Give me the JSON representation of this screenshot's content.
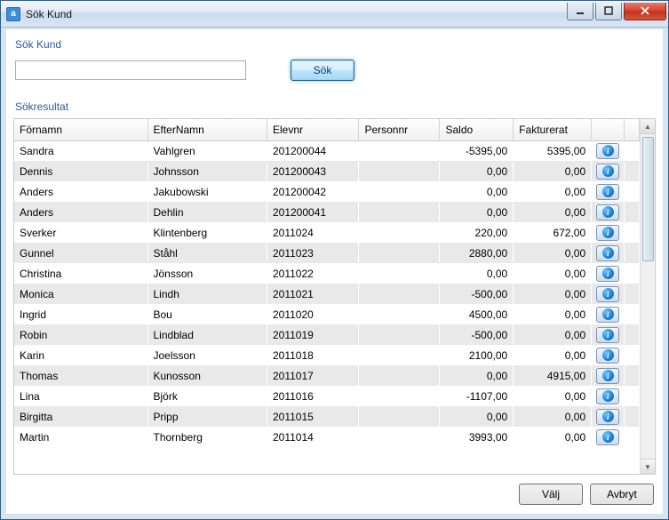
{
  "window": {
    "title": "Sök Kund"
  },
  "groups": {
    "search": "Sök Kund",
    "results": "Sökresultat"
  },
  "search": {
    "value": "",
    "button": "Sök"
  },
  "columns": {
    "fornamn": "Förnamn",
    "efternamn": "EfterNamn",
    "elevnr": "Elevnr",
    "personnr": "Personnr",
    "saldo": "Saldo",
    "fakturerat": "Fakturerat"
  },
  "rows": [
    {
      "fornamn": "Sandra",
      "efternamn": "Vahlgren",
      "elevnr": "201200044",
      "personnr": "",
      "saldo": "-5395,00",
      "fakturerat": "5395,00"
    },
    {
      "fornamn": "Dennis",
      "efternamn": "Johnsson",
      "elevnr": "201200043",
      "personnr": "",
      "saldo": "0,00",
      "fakturerat": "0,00"
    },
    {
      "fornamn": "Anders",
      "efternamn": "Jakubowski",
      "elevnr": "201200042",
      "personnr": "",
      "saldo": "0,00",
      "fakturerat": "0,00"
    },
    {
      "fornamn": "Anders",
      "efternamn": "Dehlin",
      "elevnr": "201200041",
      "personnr": "",
      "saldo": "0,00",
      "fakturerat": "0,00"
    },
    {
      "fornamn": "Sverker",
      "efternamn": "Klintenberg",
      "elevnr": "2011024",
      "personnr": "",
      "saldo": "220,00",
      "fakturerat": "672,00"
    },
    {
      "fornamn": "Gunnel",
      "efternamn": "Ståhl",
      "elevnr": "2011023",
      "personnr": "",
      "saldo": "2880,00",
      "fakturerat": "0,00"
    },
    {
      "fornamn": "Christina",
      "efternamn": "Jönsson",
      "elevnr": "2011022",
      "personnr": "",
      "saldo": "0,00",
      "fakturerat": "0,00"
    },
    {
      "fornamn": "Monica",
      "efternamn": "Lindh",
      "elevnr": "2011021",
      "personnr": "",
      "saldo": "-500,00",
      "fakturerat": "0,00"
    },
    {
      "fornamn": "Ingrid",
      "efternamn": "Bou",
      "elevnr": "2011020",
      "personnr": "",
      "saldo": "4500,00",
      "fakturerat": "0,00"
    },
    {
      "fornamn": "Robin",
      "efternamn": "Lindblad",
      "elevnr": "2011019",
      "personnr": "",
      "saldo": "-500,00",
      "fakturerat": "0,00"
    },
    {
      "fornamn": "Karin",
      "efternamn": "Joelsson",
      "elevnr": "2011018",
      "personnr": "",
      "saldo": "2100,00",
      "fakturerat": "0,00"
    },
    {
      "fornamn": "Thomas",
      "efternamn": "Kunosson",
      "elevnr": "2011017",
      "personnr": "",
      "saldo": "0,00",
      "fakturerat": "4915,00"
    },
    {
      "fornamn": "Lina",
      "efternamn": "Björk",
      "elevnr": "2011016",
      "personnr": "",
      "saldo": "-1107,00",
      "fakturerat": "0,00"
    },
    {
      "fornamn": "Birgitta",
      "efternamn": "Pripp",
      "elevnr": "2011015",
      "personnr": "",
      "saldo": "0,00",
      "fakturerat": "0,00"
    },
    {
      "fornamn": "Martin",
      "efternamn": "Thornberg",
      "elevnr": "2011014",
      "personnr": "",
      "saldo": "3993,00",
      "fakturerat": "0,00"
    }
  ],
  "footer": {
    "select": "Välj",
    "cancel": "Avbryt"
  },
  "icons": {
    "info": "i"
  }
}
